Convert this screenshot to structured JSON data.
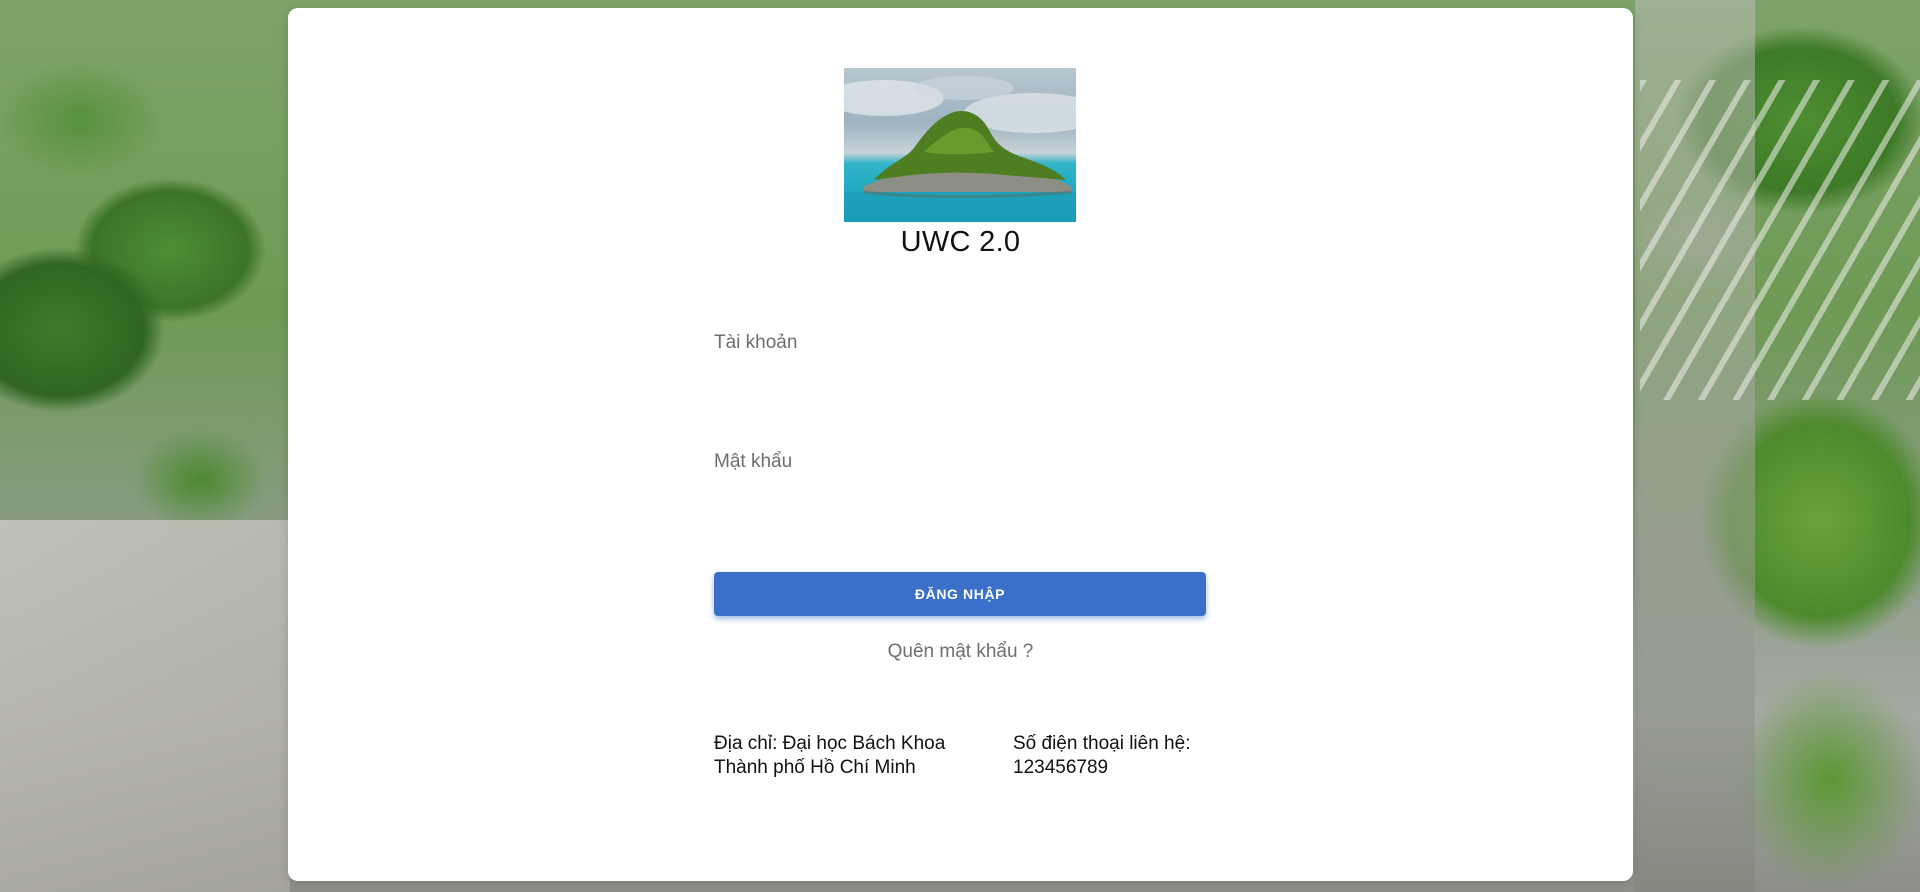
{
  "app": {
    "title": "UWC 2.0",
    "logo_icon": "island-logo-icon"
  },
  "form": {
    "username_label": "Tài khoản",
    "username_value": "",
    "password_label": "Mật khẩu",
    "password_value": "",
    "login_label": "ĐĂNG NHẬP",
    "forgot_label": "Quên mật khẩu ?"
  },
  "footer": {
    "address_line1": "Địa chỉ: Đại học Bách Khoa",
    "address_line2": "Thành phố Hồ Chí Minh",
    "phone_line1": "Số điện thoại liên hệ:",
    "phone_line2": "123456789"
  },
  "colors": {
    "primary": "#3a6fca",
    "card": "#ffffff",
    "muted_text": "#6e6e6e"
  }
}
